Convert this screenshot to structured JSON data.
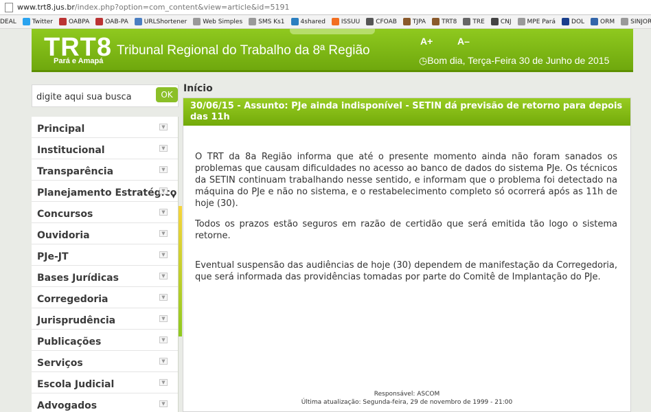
{
  "browser": {
    "url_host": "www.trt8.jus.br",
    "url_path": "/index.php?option=com_content&view=article&id=5191",
    "bookmarks": [
      {
        "label": "DEAL",
        "icon": "",
        "color": ""
      },
      {
        "label": "Twitter",
        "icon": "twitter-bird-icon",
        "color": "#2aa3ef"
      },
      {
        "label": "OABPA",
        "icon": "oab-icon",
        "color": "#b33"
      },
      {
        "label": "OAB-PA",
        "icon": "oab-icon",
        "color": "#b33"
      },
      {
        "label": "URLShortener",
        "icon": "link-icon",
        "color": "#4a7ec2"
      },
      {
        "label": "Web Simples",
        "icon": "page-icon",
        "color": "#999"
      },
      {
        "label": "SMS Ks1",
        "icon": "page-icon",
        "color": "#999"
      },
      {
        "label": "4shared",
        "icon": "4shared-icon",
        "color": "#2b7fc0"
      },
      {
        "label": "ISSUU",
        "icon": "issuu-icon",
        "color": "#f26f21"
      },
      {
        "label": "CFOAB",
        "icon": "oab-icon",
        "color": "#555"
      },
      {
        "label": "TJPA",
        "icon": "scale-icon",
        "color": "#8a5a2b"
      },
      {
        "label": "TRT8",
        "icon": "scale-icon",
        "color": "#8a5a2b"
      },
      {
        "label": "TRE",
        "icon": "tre-icon",
        "color": "#666"
      },
      {
        "label": "CNJ",
        "icon": "cnj-icon",
        "color": "#444"
      },
      {
        "label": "MPE Pará",
        "icon": "page-icon",
        "color": "#999"
      },
      {
        "label": "DOL",
        "icon": "dol-icon",
        "color": "#1a3f8c"
      },
      {
        "label": "ORM",
        "icon": "orm-icon",
        "color": "#3366aa"
      },
      {
        "label": "SINJOR-PA",
        "icon": "page-icon",
        "color": "#999"
      }
    ]
  },
  "header": {
    "logo": "TRT8",
    "logo_sub": "Pará e Amapá",
    "title": "Tribunal Regional do Trabalho da 8ª Região",
    "font_increase": "A+",
    "font_decrease": "A–",
    "greeting": "Bom dia, Terça-Feira 30 de Junho de 2015"
  },
  "search": {
    "placeholder": "digite aqui sua busca",
    "button": "OK"
  },
  "menu": [
    "Principal",
    "Institucional",
    "Transparência",
    "Planejamento Estratégico",
    "Concursos",
    "Ouvidoria",
    "PJe-JT",
    "Bases Jurídicas",
    "Corregedoria",
    "Jurisprudência",
    "Publicações",
    "Serviços",
    "Escola Judicial",
    "Advogados"
  ],
  "breadcrumb": "Início",
  "article": {
    "title": "30/06/15 - Assunto: PJe ainda indisponível - SETIN dá previsão de retorno para depois das 11h",
    "paragraphs": [
      "O TRT da 8a Região informa que até o presente momento ainda não foram sanados os problemas que causam dificuldades no acesso ao banco de dados do sistema PJe. Os técnicos da SETIN continuam trabalhando nesse sentido, e informam que o problema foi detectado na máquina do PJe e não no sistema, e o restabelecimento completo só ocorrerá após as 11h de hoje (30).",
      "Todos os prazos estão seguros em razão de certidão que será emitida tão logo o sistema retorne.",
      "Eventual suspensão das audiências de hoje (30) dependem de manifestação da Corregedoria, que será informada das providências tomadas por parte do Comitê de Implantação do PJe."
    ],
    "responsible": "Responsável: ASCOM",
    "last_update": "Última atualização: Segunda-feira, 29 de novembro de 1999 - 21:00"
  }
}
